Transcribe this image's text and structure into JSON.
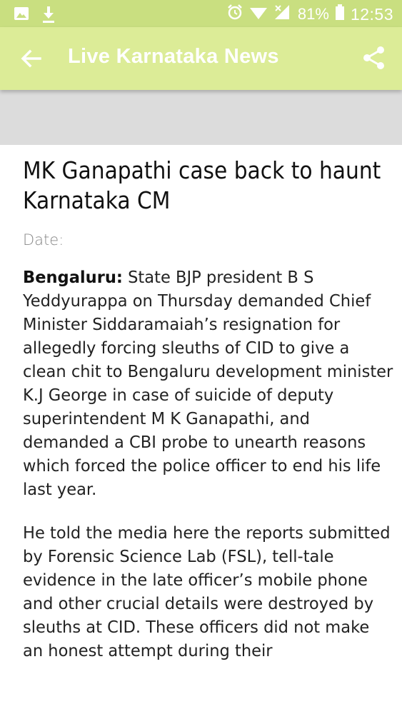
{
  "status_bar": {
    "battery": "81%",
    "time": "12:53",
    "icons": [
      "image-icon",
      "download-icon",
      "alarm-icon",
      "wifi-icon",
      "signal-icon",
      "battery-icon"
    ]
  },
  "app_bar": {
    "title": "Live Karnataka News",
    "back_icon": "arrow-left-icon",
    "share_icon": "share-icon",
    "background_color": "#dcec97"
  },
  "article": {
    "title": "MK Ganapathi case back to haunt Karnataka CM",
    "date_label": "Date:",
    "paragraphs": [
      {
        "dateline": "Bengaluru:",
        "text": " State BJP president B S Yeddyurappa on Thursday demanded Chief Minister Siddaramaiah’s resignation for allegedly forcing sleuths of CID to give a clean chit to Bengaluru development minister K.J George in case of suicide of deputy superintendent M K Ganapathi, and demanded a CBI probe to unearth reasons which forced the police officer to end his life last year."
      },
      {
        "text": "He told the media here the reports submitted by Forensic Science Lab (FSL), tell-tale evidence in the late officer’s mobile phone and other crucial details were destroyed by sleuths at CID. These officers did not make an honest attempt during their"
      }
    ]
  }
}
